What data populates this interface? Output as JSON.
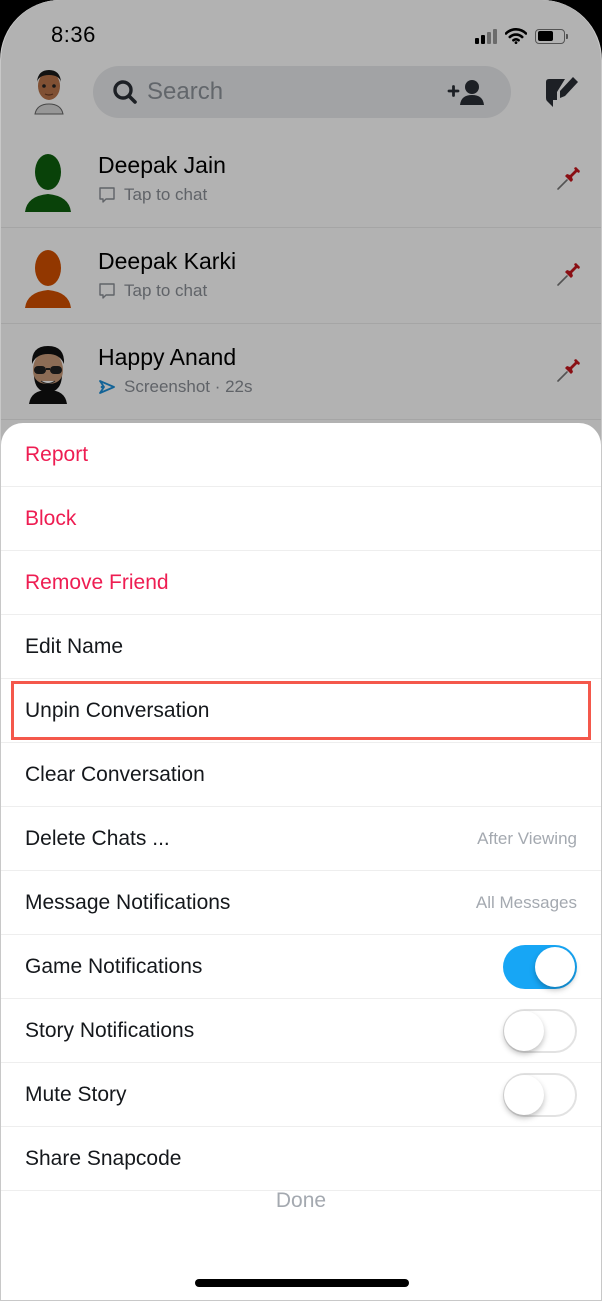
{
  "status_bar": {
    "time": "8:36",
    "signal_bars_active": 2,
    "signal_bars_total": 4,
    "battery_level": 0.6
  },
  "header": {
    "search_placeholder": "Search",
    "icons": {
      "avatar": "bitmoji-avatar",
      "search": "search-icon",
      "add_friend": "add-friend-icon",
      "new_chat": "new-chat-icon"
    }
  },
  "chats": [
    {
      "name": "Deepak Jain",
      "status": "Tap to chat",
      "status_icon": "chat-bubble-icon",
      "avatar_color": "#0e5f0e",
      "pinned": true
    },
    {
      "name": "Deepak Karki",
      "status": "Tap to chat",
      "status_icon": "chat-bubble-icon",
      "avatar_color": "#d14f00",
      "pinned": true
    },
    {
      "name": "Happy Anand",
      "status": "Screenshot · 22s",
      "status_icon": "screenshot-icon",
      "avatar_color": "bitmoji",
      "pinned": true
    }
  ],
  "sheet": {
    "items": [
      {
        "label": "Report",
        "style": "danger"
      },
      {
        "label": "Block",
        "style": "danger"
      },
      {
        "label": "Remove Friend",
        "style": "danger"
      },
      {
        "label": "Edit Name",
        "style": "normal"
      },
      {
        "label": "Unpin Conversation",
        "style": "normal",
        "highlighted": true
      },
      {
        "label": "Clear Conversation",
        "style": "normal"
      },
      {
        "label": "Delete Chats ...",
        "style": "normal",
        "value": "After Viewing"
      },
      {
        "label": "Message Notifications",
        "style": "normal",
        "value": "All Messages"
      },
      {
        "label": "Game Notifications",
        "style": "normal",
        "toggle": true
      },
      {
        "label": "Story Notifications",
        "style": "normal",
        "toggle": false
      },
      {
        "label": "Mute Story",
        "style": "normal",
        "toggle": false
      },
      {
        "label": "Share Snapcode",
        "style": "normal"
      }
    ],
    "done_label": "Done"
  },
  "colors": {
    "danger": "#ee1d52",
    "toggle_on": "#17a6f5",
    "highlight_border": "#f4584b",
    "secondary_text": "#a4a9b0"
  }
}
